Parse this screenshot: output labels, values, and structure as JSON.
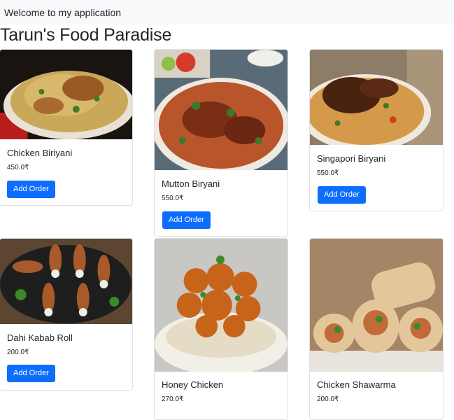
{
  "navbar": {
    "welcome_text": "Welcome to my application"
  },
  "page": {
    "title": "Tarun's Food Paradise"
  },
  "button_label": "Add Order",
  "items": [
    {
      "name": "Chicken Biriyani",
      "price": "450.0₹"
    },
    {
      "name": "Mutton Biryani",
      "price": "550.0₹"
    },
    {
      "name": "Singapori Biryani",
      "price": "550.0₹"
    },
    {
      "name": "Dahi Kabab Roll",
      "price": "200.0₹"
    },
    {
      "name": "Honey Chicken",
      "price": "270.0₹"
    },
    {
      "name": "Chicken Shawarma",
      "price": "200.0₹"
    }
  ],
  "colors": {
    "primary": "#0d6efd",
    "navbar_bg": "#f8f9fa"
  }
}
